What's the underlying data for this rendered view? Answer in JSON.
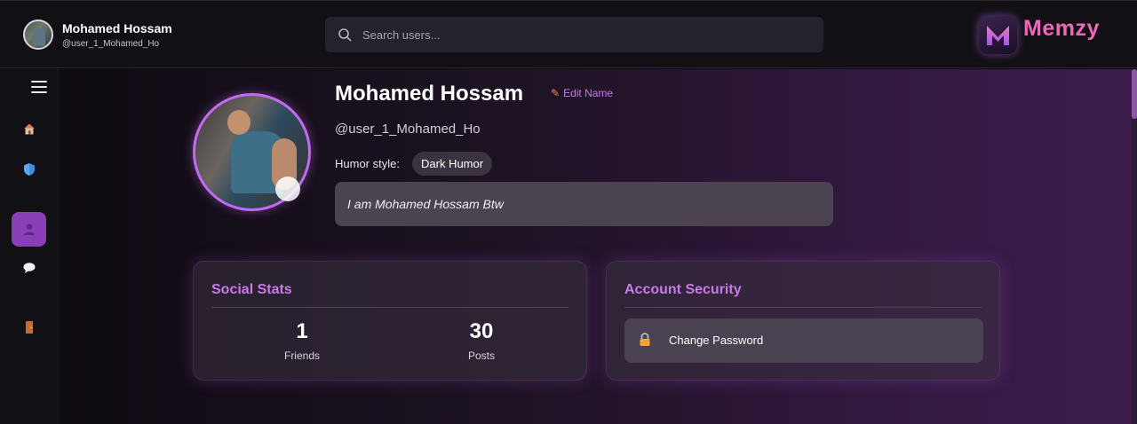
{
  "header": {
    "user_name": "Mohamed Hossam",
    "user_handle": "@user_1_Mohamed_Ho",
    "search_placeholder": "Search users...",
    "brand": "Memzy",
    "brand_color": "#e96ab6"
  },
  "sidebar": {
    "items": [
      {
        "name": "home",
        "icon": "home-icon"
      },
      {
        "name": "shield",
        "icon": "shield-icon"
      },
      {
        "name": "profile",
        "icon": "user-icon",
        "active": true
      },
      {
        "name": "chat",
        "icon": "chat-bubble-icon"
      },
      {
        "name": "logout",
        "icon": "door-icon"
      }
    ],
    "active_color": "#8a3fb8"
  },
  "profile": {
    "name": "Mohamed Hossam",
    "edit_name_label": "Edit Name",
    "handle": "@user_1_Mohamed_Ho",
    "humor_label": "Humor style:",
    "humor_value": "Dark Humor",
    "bio": "I am Mohamed Hossam Btw"
  },
  "social_stats": {
    "title": "Social Stats",
    "stats": [
      {
        "value": "1",
        "label": "Friends"
      },
      {
        "value": "30",
        "label": "Posts"
      }
    ]
  },
  "account_security": {
    "title": "Account Security",
    "change_password_label": "Change Password"
  },
  "accent_color": "#c77ae8"
}
